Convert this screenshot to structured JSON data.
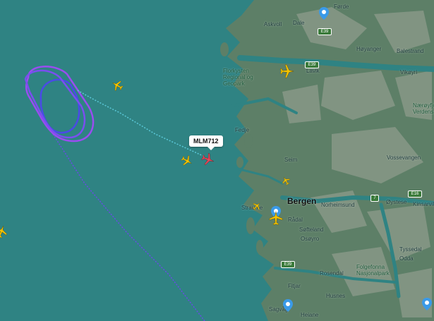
{
  "selected_flight": {
    "callsign": "MLM712"
  },
  "labels": {
    "askvoll": "Askvoll",
    "dale": "Dale",
    "hoyanger": "Høyanger",
    "balestrand": "Balestrand",
    "lavik": "Lavik",
    "vikoyri": "Vikøyri",
    "vossevangen": "Vossevangen",
    "fedje": "Fedje",
    "seim": "Seim",
    "bergen": "Bergen",
    "straume": "Straume",
    "radal": "Rådal",
    "softeland": "Søfteland",
    "osoyro": "Osøyro",
    "norheimsund": "Norheimsund",
    "oystese": "Øystese",
    "kinsarvik": "Kinsarvik",
    "tyssedal": "Tyssedal",
    "odda": "Odda",
    "rosendal": "Rosendal",
    "husnes": "Husnes",
    "fitjar": "Fitjar",
    "sagvag": "Sagvåg",
    "leirvik": "Heiane",
    "forde": "Førde",
    "flo_park": "Florkysten Regional og Geopark",
    "folgefonna": "Folgefonna Nasjonalpark",
    "verdens": "Nærøyfjord Verdensarv"
  },
  "road_shields": {
    "e39_north": "E39",
    "e16": "E16",
    "e39_lavik": "E39",
    "rv7": "7",
    "e39_south": "E39"
  },
  "colors": {
    "sea": "#2f8383",
    "land": "#5d7f67",
    "path_recent": "#9a4df0",
    "path_old": "#4a4ae8",
    "plane_selected": "#e8475a",
    "plane": "#f5c400"
  }
}
